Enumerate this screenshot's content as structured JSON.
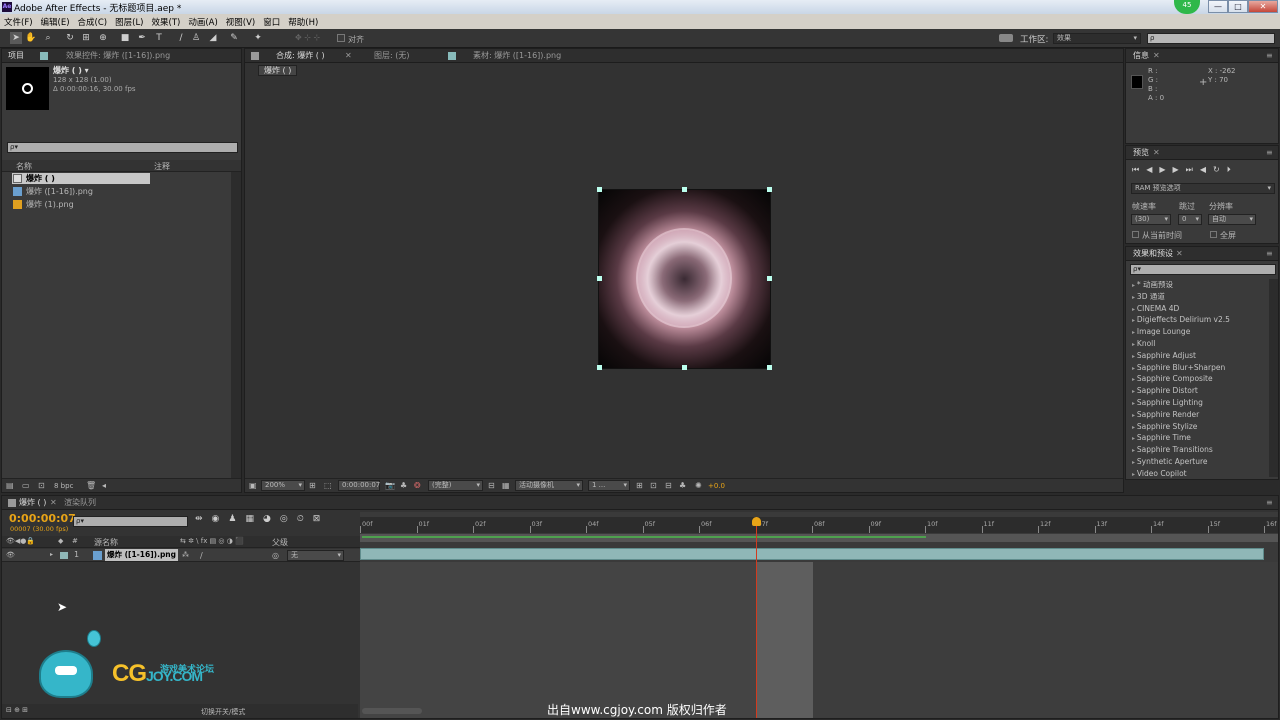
{
  "window": {
    "app_icon": "Ae",
    "title": "Adobe After Effects - 无标题项目.aep *",
    "badge": "45",
    "min": "—",
    "max": "□",
    "close": "✕"
  },
  "menu": [
    "文件(F)",
    "编辑(E)",
    "合成(C)",
    "图层(L)",
    "效果(T)",
    "动画(A)",
    "视图(V)",
    "窗口",
    "帮助(H)"
  ],
  "toolbar": {
    "align_label": "对齐",
    "workspace_label": "工作区:",
    "workspace_value": "效果",
    "search_placeholder": "ρ"
  },
  "project_panel": {
    "tabs": [
      "项目",
      "效果控件: 爆炸 ([1-16]).png"
    ],
    "comp_name": "爆炸 ( ) ▾",
    "comp_size": "128 x 128 (1.00)",
    "comp_duration": "Δ 0:00:00:16, 30.00 fps",
    "search": "ρ▾",
    "col_name": "名称",
    "col_comment": "注释",
    "items": [
      {
        "name": "爆炸 ( )",
        "type": "comp"
      },
      {
        "name": "爆炸 ([1-16]).png",
        "type": "sequence"
      },
      {
        "name": "爆炸 (1).png",
        "type": "image"
      }
    ],
    "bpc": "8 bpc"
  },
  "comp_panel": {
    "tabs": [
      "合成: 爆炸 ( )",
      "图层: (无)",
      "素材: 爆炸 ([1-16]).png"
    ],
    "breadcrumb": "爆炸 ( )",
    "zoom": "200%",
    "timecode": "0:00:00:07",
    "quality": "(完整)",
    "camera": "活动摄像机",
    "views": "1 ...",
    "exposure": "+0.0"
  },
  "info_panel": {
    "tab": "信息",
    "r": "R :",
    "g": "G :",
    "b": "B :",
    "a": "A : 0",
    "x": "X : -262",
    "y": "Y : 70"
  },
  "preview_panel": {
    "tab": "预览",
    "ram_options": "RAM 预览选项",
    "frame_rate_label": "帧速率",
    "skip_label": "跳过",
    "resolution_label": "分辨率",
    "frame_rate_value": "(30)",
    "skip_value": "0",
    "resolution_value": "自动",
    "from_current": "从当前时间",
    "fullscreen": "全屏"
  },
  "effects_panel": {
    "tab": "效果和预设",
    "search": "ρ▾",
    "items": [
      "* 动画预设",
      "3D 通道",
      "CINEMA 4D",
      "Digieffects Delirium v2.5",
      "Image Lounge",
      "Knoll",
      "Sapphire Adjust",
      "Sapphire Blur+Sharpen",
      "Sapphire Composite",
      "Sapphire Distort",
      "Sapphire Lighting",
      "Sapphire Render",
      "Sapphire Stylize",
      "Sapphire Time",
      "Sapphire Transitions",
      "Synthetic Aperture",
      "Video Copilot"
    ]
  },
  "timeline": {
    "tabs": [
      "爆炸 ( )",
      "渲染队列"
    ],
    "timecode": "0:00:00:07",
    "frame_info": "00007 (30.00 fps)",
    "search": "ρ▾",
    "col_source": "源名称",
    "col_parent": "父级",
    "col_num": "#",
    "layer_num": "1",
    "layer_name": "爆炸 ([1-16]).png",
    "parent_value": "无",
    "ruler": [
      "00f",
      "01f",
      "02f",
      "03f",
      "04f",
      "05f",
      "06f",
      "07f",
      "08f",
      "09f",
      "10f",
      "11f",
      "12f",
      "13f",
      "14f",
      "15f",
      "16f"
    ],
    "toggle_label": "切换开关/模式",
    "playhead_frame": 7,
    "total_frames": 16
  },
  "watermark": {
    "logo_text": "CGJOY.COM",
    "logo_sub": "游戏美术论坛",
    "credit": "出自www.cgjoy.com 版权归作者"
  },
  "colors": {
    "accent": "#e8a417",
    "layer_bar": "#8fb7b7",
    "playhead": "#d23b1f"
  }
}
